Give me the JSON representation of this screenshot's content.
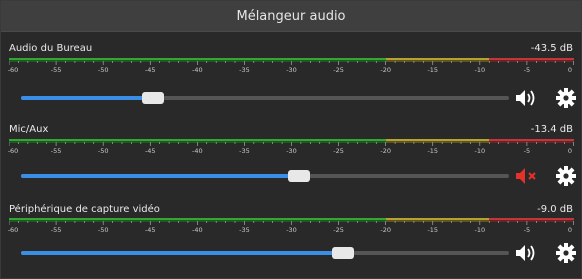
{
  "window": {
    "title": "Mélangeur audio"
  },
  "scale": {
    "labels": [
      "-60",
      "-55",
      "-50",
      "-45",
      "-40",
      "-35",
      "-30",
      "-25",
      "-20",
      "-15",
      "-10",
      "-5",
      "0"
    ]
  },
  "tracks": [
    {
      "name": "Audio du Bureau",
      "db": "-43.5 dB",
      "volume_fraction": 0.27,
      "muted": false,
      "mute_icon": "speaker-icon",
      "settings_icon": "gear-icon"
    },
    {
      "name": "Mic/Aux",
      "db": "-13.4 dB",
      "volume_fraction": 0.57,
      "muted": true,
      "mute_icon": "speaker-muted-icon",
      "settings_icon": "gear-icon"
    },
    {
      "name": "Périphérique de capture vidéo",
      "db": "-9.0 dB",
      "volume_fraction": 0.66,
      "muted": false,
      "mute_icon": "speaker-icon",
      "settings_icon": "gear-icon"
    }
  ],
  "colors": {
    "accent": "#3b8ee5",
    "meter_green": "#35a635",
    "meter_yellow": "#b5a22f",
    "meter_red": "#c0363a",
    "mute_red": "#e5302b"
  }
}
